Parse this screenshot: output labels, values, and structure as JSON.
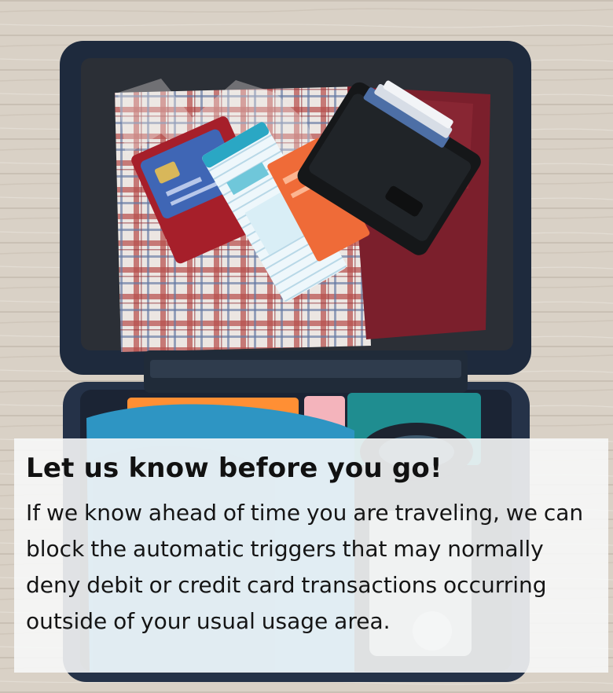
{
  "promo": {
    "image_icon": "suitcase-photo",
    "headline": "Let us know before you go!",
    "body": "If we know ahead of time you are traveling, we can block the automatic triggers that may normally deny debit or credit card transactions occurring outside of your usual usage area."
  },
  "colors": {
    "caption_background": "#f7f8f8",
    "text": "#111111",
    "wood_floor": "#d8d0c5",
    "suitcase": "#223047"
  }
}
